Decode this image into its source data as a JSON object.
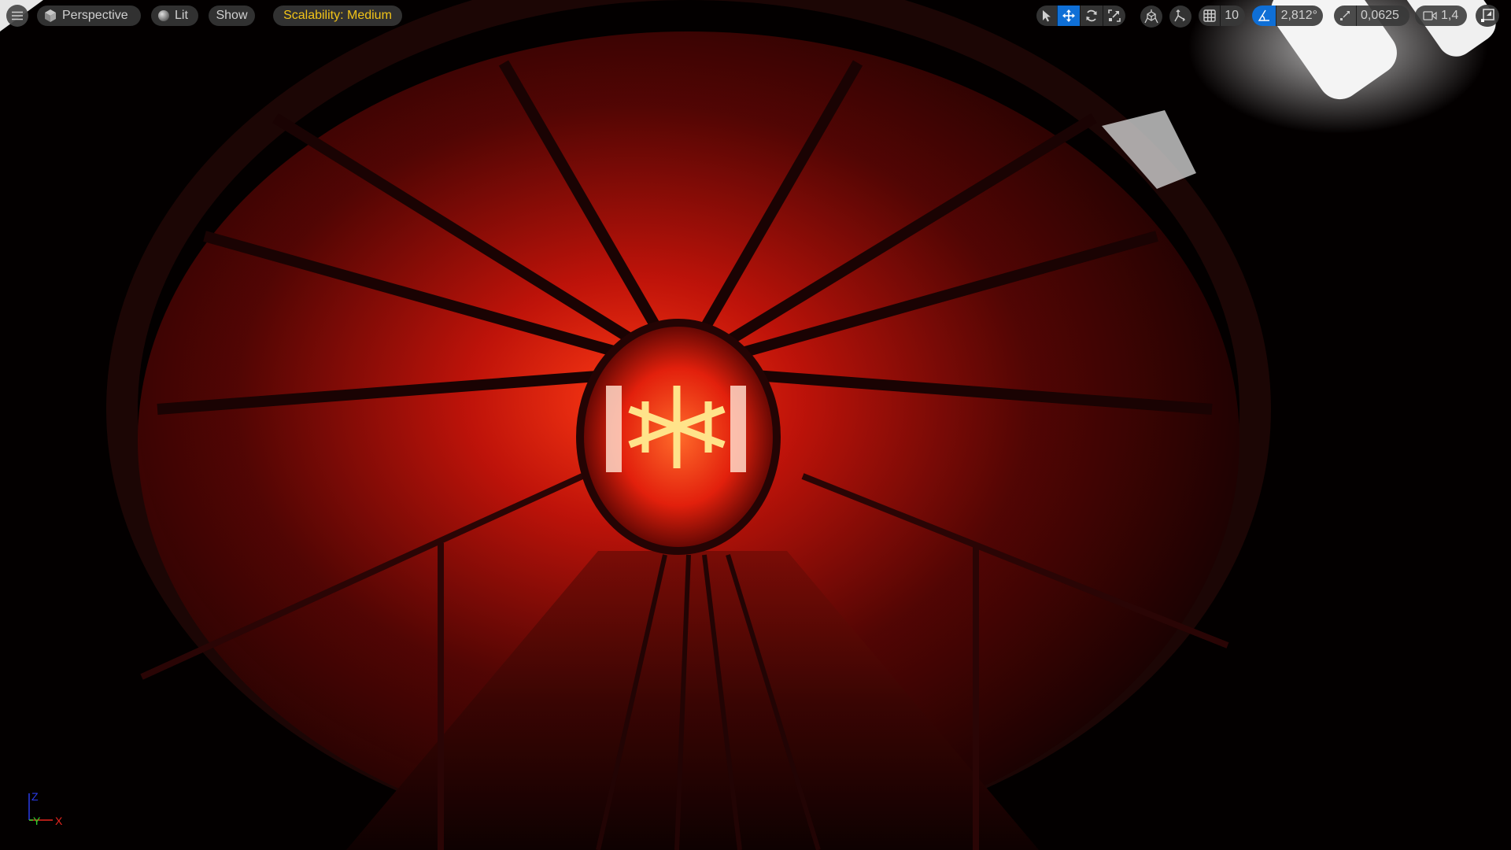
{
  "viewport": {
    "left_toolbar": {
      "menu_icon": "hamburger-menu-icon",
      "view_mode": {
        "icon": "perspective-cube-icon",
        "label": "Perspective"
      },
      "lighting": {
        "icon": "lit-sphere-icon",
        "label": "Lit"
      },
      "show": {
        "label": "Show"
      },
      "scalability": {
        "label": "Scalability: Medium",
        "color": "#f2c418"
      }
    },
    "right_toolbar": {
      "transform_tools": [
        {
          "name": "select",
          "icon": "cursor-arrow-icon",
          "active": false
        },
        {
          "name": "translate",
          "icon": "move-arrows-icon",
          "active": true
        },
        {
          "name": "rotate",
          "icon": "rotate-icon",
          "active": false
        },
        {
          "name": "scale",
          "icon": "scale-icon",
          "active": false
        }
      ],
      "surface_snapping_icon": "surface-snap-icon",
      "coordinate_system_icon": "world-local-icon",
      "grid_snap": {
        "icon": "grid-icon",
        "value": "10",
        "active": false
      },
      "rotation_snap": {
        "icon": "angle-icon",
        "value": "2,812°",
        "active": true
      },
      "scale_snap": {
        "icon": "scale-arrow-icon",
        "value": "0,0625",
        "active": false
      },
      "camera_speed": {
        "icon": "camera-icon",
        "value": "1,4"
      },
      "maximize_icon": "maximize-viewport-icon"
    },
    "axis_gizmo": {
      "x_label": "X",
      "y_label": "Y",
      "z_label": "Z",
      "x_color": "#e8251e",
      "y_color": "#2fd52a",
      "z_color": "#2a3be8"
    },
    "colors": {
      "accent_blue": "#0f6fd6",
      "scene_red": "#e01b0c",
      "scene_glow": "#ffd27a"
    }
  }
}
